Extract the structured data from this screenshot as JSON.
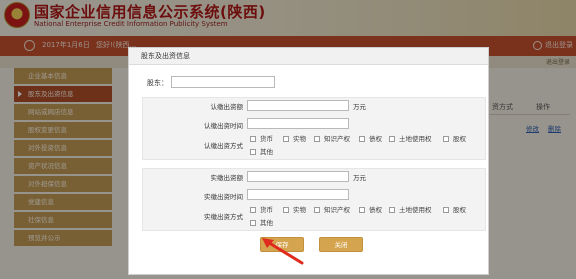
{
  "header": {
    "title_cn": "国家企业信用信息公示系统(陕西)",
    "title_en": "National Enterprise Credit Information Publicity System"
  },
  "toolbar": {
    "date": "2017年1月6日",
    "user": "您好!(陕西...",
    "logout": "退出登录"
  },
  "subbar": {
    "help": "退出登录"
  },
  "sidebar": {
    "items": [
      {
        "label": "企业基本信息"
      },
      {
        "label": "股东及出资信息"
      },
      {
        "label": "网站或网店信息"
      },
      {
        "label": "股权变更信息"
      },
      {
        "label": "对外投资信息"
      },
      {
        "label": "资产状况信息"
      },
      {
        "label": "对外担保信息"
      },
      {
        "label": "党建信息"
      },
      {
        "label": "社保信息"
      },
      {
        "label": "预览并公示"
      }
    ],
    "active_index": 1
  },
  "background_table": {
    "col_method": "资方式",
    "col_ops": "操作",
    "edit": "修改",
    "delete": "删除"
  },
  "dialog": {
    "title": "股东及出资信息",
    "shareholder_label": "股东：",
    "subscribed": {
      "amount_label": "认缴出资额",
      "unit": "万元",
      "time_label": "认缴出资时间",
      "method_label": "认缴出资方式",
      "methods": [
        "货币",
        "实物",
        "知识产权",
        "债权",
        "土地使用权",
        "股权",
        "其他"
      ]
    },
    "paid": {
      "amount_label": "实缴出资额",
      "unit": "万元",
      "time_label": "实缴出资时间",
      "method_label": "实缴出资方式",
      "methods": [
        "货币",
        "实物",
        "知识产权",
        "债权",
        "土地使用权",
        "股权",
        "其他"
      ]
    },
    "buttons": {
      "save": "保存",
      "close": "关闭"
    }
  },
  "colors": {
    "toolbar": "#c7522f",
    "sidebar": "#c49b55",
    "sidebar_active": "#b0502b",
    "button": "#d4a54e",
    "arrow": "#e02b1f"
  }
}
